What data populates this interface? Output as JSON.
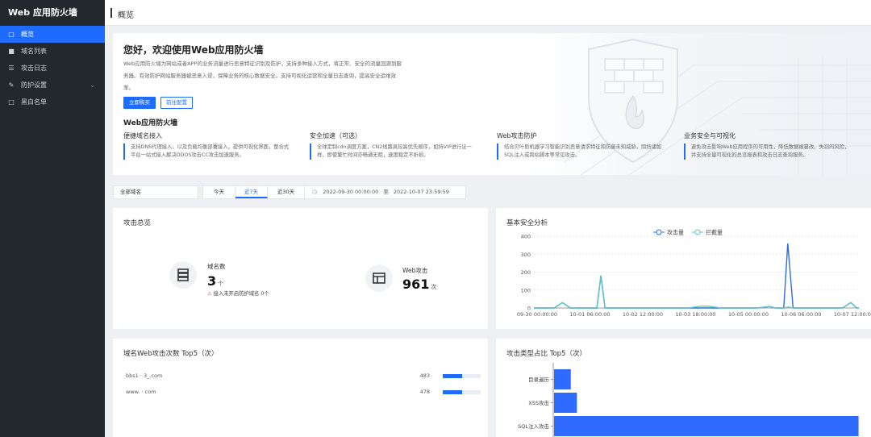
{
  "app": {
    "title": "Web 应用防火墙"
  },
  "sidebar": {
    "items": [
      {
        "label": "概览",
        "icon": "monitor-icon",
        "active": true
      },
      {
        "label": "域名列表",
        "icon": "bookmark-icon"
      },
      {
        "label": "攻击日志",
        "icon": "list-icon"
      },
      {
        "label": "防护设置",
        "icon": "edit-icon",
        "has_children": true
      },
      {
        "label": "黑白名单",
        "icon": "lock-icon"
      }
    ]
  },
  "header": {
    "title": "概览"
  },
  "welcome": {
    "title": "您好，欢迎使用Web应用防火墙",
    "description": "Web应用防火墙为网站或者APP的业务流量进行恶意特征识别及防护，支持多种接入方式，将正常、安全的流量回源到服务器。有效防护网站服务器被恶意入侵，保障业务的核心数据安全。支持可视化运营和全量日志查询，提高安全运维效率。",
    "buy_button": "立即购买",
    "config_button": "前往配置",
    "subtitle": "Web应用防火墙",
    "features": [
      {
        "title": "便捷域名接入",
        "desc": "支持DNS代理接入，以及负载均衡部署接入，提供可视化界面，整合式平台一站式接入解决DDOS攻击CC攻击加速服务。"
      },
      {
        "title": "安全加速（可选）",
        "desc": "全球定制cdn调度方案，CN2线路具较高优先顺序，如持VIP进行证一样，即使繁忙时间亦畅通无阻，速度稳定不折损。"
      },
      {
        "title": "Web攻击防护",
        "desc": "结合贝叶斯机器学习智能识别恶意请求特征和防御未知威胁，阻挡诸如SQL注入或跨站脚本等常见攻击。"
      },
      {
        "title": "业务安全与可视化",
        "desc": "避免攻击影响Web应用程序的可用性，降低数据被篡改、失窃的风险，并支持全量可视化的总览报表和攻击日志查询服务。"
      }
    ]
  },
  "filters": {
    "domain_select": "全部域名",
    "tabs": [
      {
        "label": "今天"
      },
      {
        "label": "近7天",
        "active": true
      },
      {
        "label": "近30天"
      }
    ],
    "range_start": "2022-09-30 00:00:00",
    "range_sep": "至",
    "range_end": "2022-10-07 23:59:59"
  },
  "attack_overview": {
    "title": "攻击总览",
    "domains_label": "域名数",
    "domains_value": "3",
    "domains_unit": "个",
    "unprotected_note": "接入未开启防护域名 0个",
    "web_attack_label": "Web攻击",
    "web_attack_value": "961",
    "web_attack_unit": "次"
  },
  "security_chart": {
    "title": "基本安全分析",
    "legend": [
      "攻击量",
      "拦截量"
    ],
    "colors": {
      "attacks": "#2f6bdf",
      "blocked": "#5ec4c4"
    },
    "chart_data": {
      "type": "line",
      "x_ticks": [
        "09-30 00:00:00",
        "10-01 06:00:00",
        "10-02 12:00:00",
        "10-03 18:00:00",
        "10-05 00:00:00",
        "10-06 06:00:00",
        "10-07 12:00:00"
      ],
      "x_range_days": [
        0,
        8
      ],
      "ylim": [
        0,
        400
      ],
      "y_ticks": [
        0,
        100,
        200,
        300,
        400
      ],
      "grid": true,
      "series": [
        {
          "name": "攻击量",
          "points": [
            [
              0,
              0
            ],
            [
              0.5,
              0
            ],
            [
              0.7,
              30
            ],
            [
              0.9,
              0
            ],
            [
              1.55,
              0
            ],
            [
              1.65,
              180
            ],
            [
              1.75,
              0
            ],
            [
              5.5,
              0
            ],
            [
              5.8,
              8
            ],
            [
              5.95,
              0
            ],
            [
              6.15,
              0
            ],
            [
              6.25,
              360
            ],
            [
              6.38,
              0
            ],
            [
              7.6,
              0
            ],
            [
              7.8,
              30
            ],
            [
              7.95,
              0
            ],
            [
              8,
              0
            ]
          ]
        },
        {
          "name": "拦截量",
          "points": [
            [
              0,
              0
            ],
            [
              0.5,
              0
            ],
            [
              0.7,
              30
            ],
            [
              0.9,
              0
            ],
            [
              1.55,
              0
            ],
            [
              1.65,
              180
            ],
            [
              1.75,
              0
            ],
            [
              3.8,
              0
            ],
            [
              4.1,
              10
            ],
            [
              4.3,
              10
            ],
            [
              4.6,
              0
            ],
            [
              5.5,
              0
            ],
            [
              5.8,
              8
            ],
            [
              5.95,
              0
            ],
            [
              6.15,
              0
            ],
            [
              6.25,
              5
            ],
            [
              6.38,
              0
            ],
            [
              7.6,
              0
            ],
            [
              7.8,
              30
            ],
            [
              7.95,
              0
            ],
            [
              8,
              0
            ]
          ]
        }
      ]
    }
  },
  "domain_top5": {
    "title": "域名Web攻击次数 Top5（次）",
    "max": 483,
    "rows": [
      {
        "name": "bbs1 · 3_.com",
        "count": 483
      },
      {
        "name": "www. · com",
        "count": 478
      }
    ]
  },
  "type_top5": {
    "title": "攻击类型占比 Top5（次）",
    "chart_data": {
      "type": "bar",
      "orientation": "horizontal",
      "categories": [
        "目录遍历",
        "XSS攻击",
        "SQL注入攻击"
      ],
      "values": [
        22,
        30,
        400
      ],
      "xlim": [
        0,
        410
      ]
    },
    "color": "#2f6bff"
  }
}
